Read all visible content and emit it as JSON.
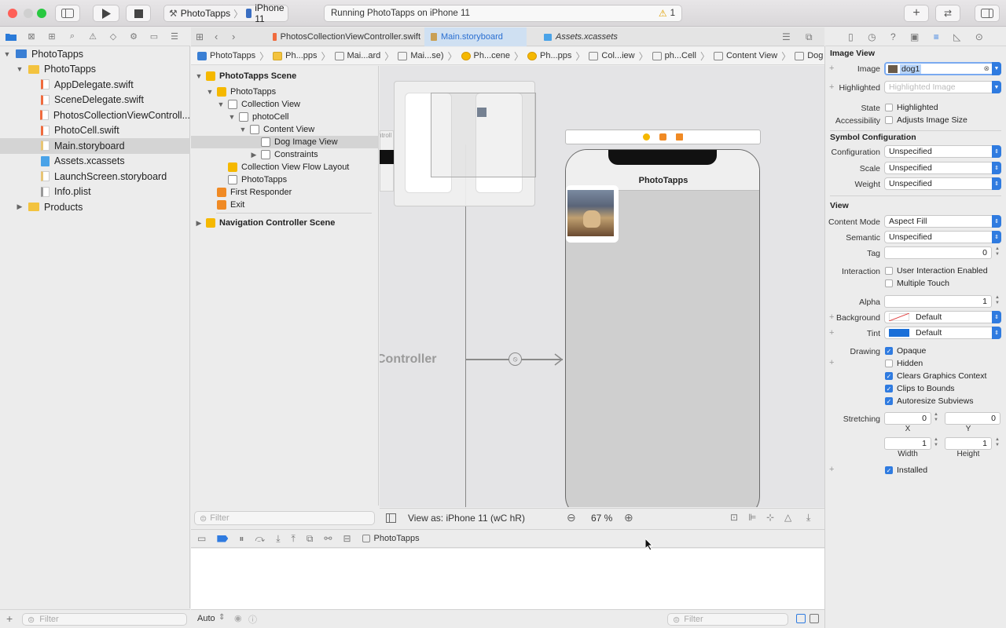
{
  "titlebar": {
    "scheme_project": "PhotoTapps",
    "scheme_device": "iPhone 11",
    "activity": "Running PhotoTapps on iPhone 11",
    "warning_count": "1"
  },
  "navigator": {
    "items": [
      {
        "label": "PhotoTapps",
        "level": 0,
        "kind": "project",
        "expanded": true
      },
      {
        "label": "PhotoTapps",
        "level": 1,
        "kind": "folder",
        "expanded": true
      },
      {
        "label": "AppDelegate.swift",
        "level": 2,
        "kind": "swift"
      },
      {
        "label": "SceneDelegate.swift",
        "level": 2,
        "kind": "swift"
      },
      {
        "label": "PhotosCollectionViewControll...",
        "level": 2,
        "kind": "swift"
      },
      {
        "label": "PhotoCell.swift",
        "level": 2,
        "kind": "swift"
      },
      {
        "label": "Main.storyboard",
        "level": 2,
        "kind": "storyboard",
        "selected": true
      },
      {
        "label": "Assets.xcassets",
        "level": 2,
        "kind": "assets"
      },
      {
        "label": "LaunchScreen.storyboard",
        "level": 2,
        "kind": "storyboard"
      },
      {
        "label": "Info.plist",
        "level": 2,
        "kind": "plist"
      },
      {
        "label": "Products",
        "level": 1,
        "kind": "folder",
        "expanded": false
      }
    ],
    "filter_placeholder": "Filter"
  },
  "tabs": [
    {
      "label": "PhotosCollectionViewController.swift",
      "active": false
    },
    {
      "label": "Main.storyboard",
      "active": true
    },
    {
      "label": "Assets.xcassets",
      "active": false
    }
  ],
  "jumpbar": [
    "PhotoTapps",
    "Ph...pps",
    "Mai...ard",
    "Mai...se)",
    "Ph...cene",
    "Ph...pps",
    "Col...iew",
    "ph...Cell",
    "Content View",
    "Dog Image View"
  ],
  "outline": {
    "items": [
      {
        "label": "PhotoTapps Scene",
        "level": 0,
        "bold": true,
        "disc": "▼"
      },
      {
        "label": "PhotoTapps",
        "level": 1,
        "disc": "▼"
      },
      {
        "label": "Collection View",
        "level": 2,
        "disc": "▼"
      },
      {
        "label": "photoCell",
        "level": 3,
        "disc": "▼"
      },
      {
        "label": "Content View",
        "level": 4,
        "disc": "▼"
      },
      {
        "label": "Dog Image View",
        "level": 5,
        "disc": "",
        "selected": true
      },
      {
        "label": "Constraints",
        "level": 5,
        "disc": "▶"
      },
      {
        "label": "Collection View Flow Layout",
        "level": 2,
        "disc": ""
      },
      {
        "label": "PhotoTapps",
        "level": 2,
        "disc": ""
      },
      {
        "label": "First Responder",
        "level": 1,
        "disc": ""
      },
      {
        "label": "Exit",
        "level": 1,
        "disc": ""
      },
      {
        "label": "Navigation Controller Scene",
        "level": 0,
        "bold": true,
        "disc": "▶"
      }
    ],
    "filter_placeholder": "Filter"
  },
  "canvas": {
    "controller_label": "Controller",
    "nav_title": "PhotoTapps",
    "view_as": "View as: iPhone 11 (wC hR)",
    "zoom": "67 %"
  },
  "debug": {
    "target": "PhotoTapps",
    "auto_label": "Auto",
    "filter_placeholder": "Filter"
  },
  "inspector": {
    "image_view_title": "Image View",
    "image_label": "Image",
    "image_value": "dog1",
    "highlighted_label": "Highlighted",
    "highlighted_placeholder": "Highlighted Image",
    "state_label": "State",
    "state_value": "Highlighted",
    "accessibility_label": "Accessibility",
    "accessibility_value": "Adjusts Image Size",
    "symbol_title": "Symbol Configuration",
    "configuration_label": "Configuration",
    "configuration_value": "Unspecified",
    "scale_label": "Scale",
    "scale_value": "Unspecified",
    "weight_label": "Weight",
    "weight_value": "Unspecified",
    "view_title": "View",
    "content_mode_label": "Content Mode",
    "content_mode_value": "Aspect Fill",
    "semantic_label": "Semantic",
    "semantic_value": "Unspecified",
    "tag_label": "Tag",
    "tag_value": "0",
    "interaction_label": "Interaction",
    "user_interaction": "User Interaction Enabled",
    "multiple_touch": "Multiple Touch",
    "alpha_label": "Alpha",
    "alpha_value": "1",
    "background_label": "Background",
    "background_value": "Default",
    "tint_label": "Tint",
    "tint_value": "Default",
    "drawing_label": "Drawing",
    "opaque": "Opaque",
    "hidden": "Hidden",
    "clears_graphics": "Clears Graphics Context",
    "clips_bounds": "Clips to Bounds",
    "autoresize": "Autoresize Subviews",
    "stretching_label": "Stretching",
    "stretch_x": "0",
    "stretch_y": "0",
    "x_label": "X",
    "y_label": "Y",
    "stretch_w": "1",
    "stretch_h": "1",
    "width_label": "Width",
    "height_label": "Height",
    "installed": "Installed"
  },
  "colors": {
    "accent": "#2f7be0",
    "selection": "#d4d4d4",
    "tint_swatch": "#1a6fd8"
  }
}
